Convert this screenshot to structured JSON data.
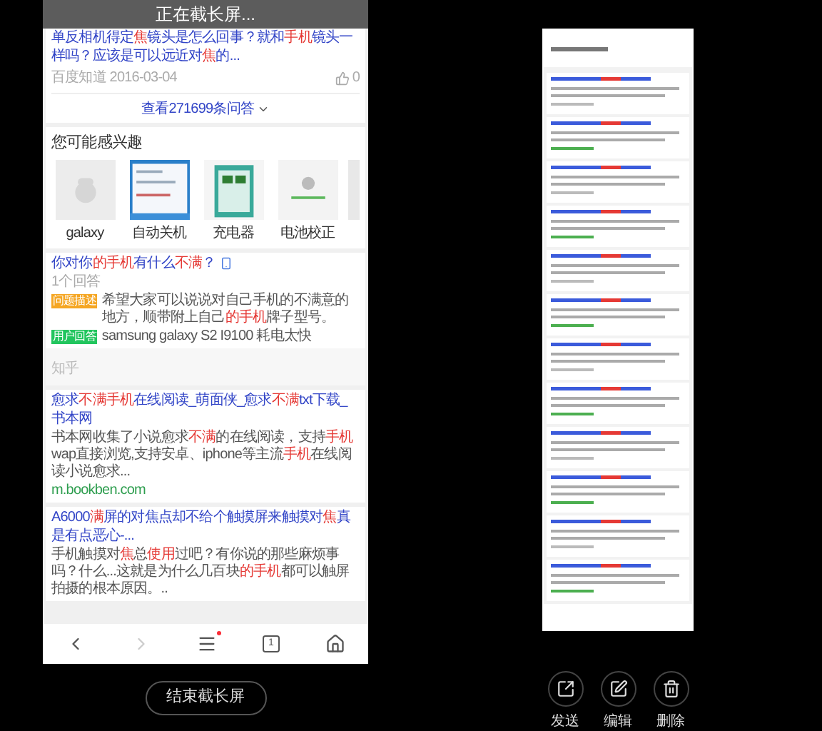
{
  "capture_banner": "正在截长屏...",
  "top_result": {
    "title": [
      {
        "t": "单反相机得定",
        "hl": false
      },
      {
        "t": "焦",
        "hl": true
      },
      {
        "t": "镜头是怎么回事？就和",
        "hl": false
      },
      {
        "t": "手机",
        "hl": true
      },
      {
        "t": "镜头一样吗？应该是可以远近对",
        "hl": false
      },
      {
        "t": "焦",
        "hl": true
      },
      {
        "t": "的...",
        "hl": false
      }
    ],
    "source": "百度知道",
    "date": "2016-03-04",
    "likes": "0",
    "more": "查看271699条问答"
  },
  "interest": {
    "title": "您可能感兴趣",
    "items": [
      {
        "label": "galaxy"
      },
      {
        "label": "自动关机"
      },
      {
        "label": "充电器"
      },
      {
        "label": "电池校正"
      }
    ]
  },
  "results": [
    {
      "kind": "qa",
      "title": [
        {
          "t": "你对你",
          "hl": false
        },
        {
          "t": "的手机",
          "hl": true
        },
        {
          "t": "有什么",
          "hl": false
        },
        {
          "t": "不满",
          "hl": true
        },
        {
          "t": "？",
          "hl": false
        }
      ],
      "answers": "1个回答",
      "rows": [
        {
          "tag": "问题描述",
          "color": "#f5a623",
          "text": [
            {
              "t": "希望大家可以说说对自己手机的不满意的地方，顺带附上自己",
              "hl": false
            },
            {
              "t": "的手机",
              "hl": true
            },
            {
              "t": "牌子型号。",
              "hl": false
            }
          ]
        },
        {
          "tag": "用户回答",
          "color": "#22c55e",
          "text": [
            {
              "t": "samsung galaxy S2 I9100 耗电太快",
              "hl": false
            }
          ]
        }
      ],
      "footer": "知乎"
    },
    {
      "kind": "web",
      "title": [
        {
          "t": "愈求",
          "hl": false
        },
        {
          "t": "不满手机",
          "hl": true
        },
        {
          "t": "在线阅读_萌面侠_愈求",
          "hl": false
        },
        {
          "t": "不满",
          "hl": true
        },
        {
          "t": "txt下载_书本网",
          "hl": false
        }
      ],
      "desc": [
        {
          "t": "书本网收集了小说愈求",
          "hl": false
        },
        {
          "t": "不满",
          "hl": true
        },
        {
          "t": "的在线阅读，支持",
          "hl": false
        },
        {
          "t": "手机",
          "hl": true
        },
        {
          "t": "wap直接浏览,支持安卓、iphone等主流",
          "hl": false
        },
        {
          "t": "手机",
          "hl": true
        },
        {
          "t": "在线阅读小说愈求...",
          "hl": false
        }
      ],
      "url": "m.bookben.com"
    },
    {
      "kind": "web",
      "title": [
        {
          "t": "A6000",
          "hl": false
        },
        {
          "t": "满",
          "hl": true
        },
        {
          "t": "屏的对焦点却不给个触摸屏来触摸对",
          "hl": false
        },
        {
          "t": "焦",
          "hl": true
        },
        {
          "t": "真是有点恶心-...",
          "hl": false
        }
      ],
      "desc": [
        {
          "t": "手机触摸对",
          "hl": false
        },
        {
          "t": "焦",
          "hl": true
        },
        {
          "t": "总",
          "hl": false
        },
        {
          "t": "使用",
          "hl": true
        },
        {
          "t": "过吧？有你说的那些麻烦事吗？什么...这就是为什么几百块",
          "hl": false
        },
        {
          "t": "的手机",
          "hl": true
        },
        {
          "t": "都可以触屏拍摄的根本原因。..",
          "hl": false
        }
      ]
    }
  ],
  "nav": {
    "forward_disabled": true,
    "menu_badge": true,
    "tab_count": "1"
  },
  "end_button": "结束截长屏",
  "actions": [
    {
      "kind": "share",
      "label": "发送"
    },
    {
      "kind": "edit",
      "label": "编辑"
    },
    {
      "kind": "delete",
      "label": "删除"
    }
  ]
}
